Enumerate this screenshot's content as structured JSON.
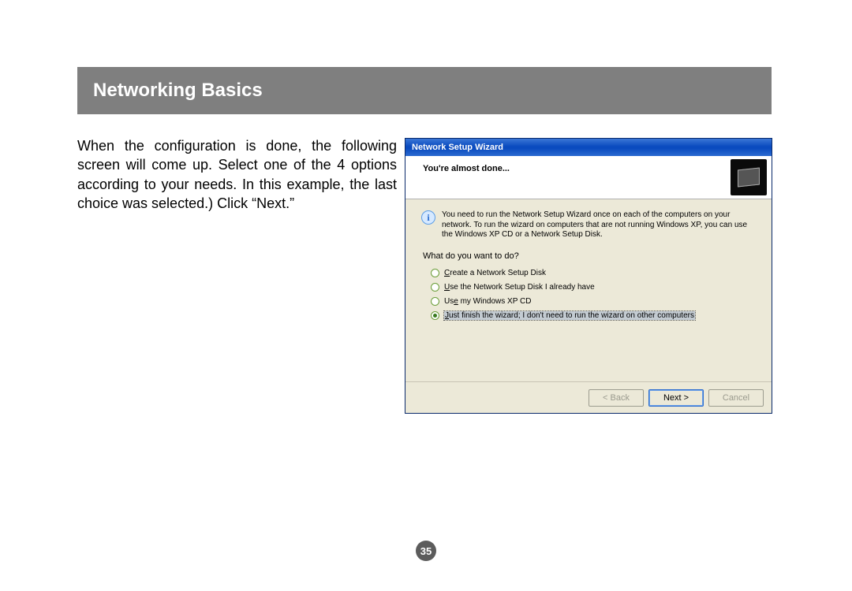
{
  "header": {
    "title": "Networking Basics"
  },
  "body_text": "When the configuration is done, the following screen will come up. Select one of the 4 options according to your needs. In this example, the last choice was selected.) Click “Next.”",
  "wizard": {
    "window_title": "Network Setup Wizard",
    "header_title": "You're almost done...",
    "info_text": "You need to run the Network Setup Wizard once on each of the computers on your network. To run the wizard on computers that are not running Windows XP, you can use the Windows XP CD or a Network Setup Disk.",
    "prompt": "What do you want to do?",
    "options": [
      {
        "label_pre": "",
        "label_u": "C",
        "label_post": "reate a Network Setup Disk",
        "selected": false
      },
      {
        "label_pre": "",
        "label_u": "U",
        "label_post": "se the Network Setup Disk I already have",
        "selected": false
      },
      {
        "label_pre": "Us",
        "label_u": "e",
        "label_post": " my Windows XP CD",
        "selected": false
      },
      {
        "label_pre": "",
        "label_u": "J",
        "label_post": "ust finish the wizard; I don't need to run the wizard on other computers",
        "selected": true
      }
    ],
    "buttons": {
      "back": "< Back",
      "next": "Next >",
      "cancel": "Cancel"
    }
  },
  "page_number": "35"
}
